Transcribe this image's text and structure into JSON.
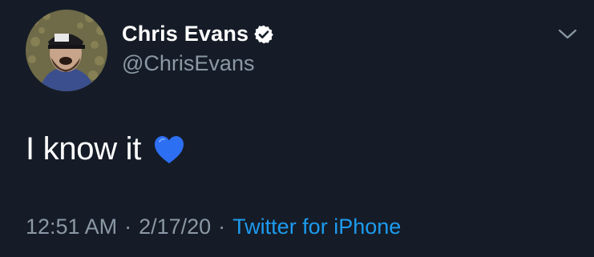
{
  "user": {
    "display_name": "Chris Evans",
    "handle": "@ChrisEvans",
    "verified_icon": "verified-badge-icon",
    "avatar_icon": "profile-photo"
  },
  "tweet": {
    "text": "I know it",
    "emoji_icon": "blue-heart-icon",
    "emoji_color": "#2d6ff3"
  },
  "meta": {
    "time": "12:51 AM",
    "separator": "·",
    "date": "2/17/20",
    "source": "Twitter for iPhone"
  },
  "menu": {
    "icon": "chevron-down-icon"
  },
  "colors": {
    "background": "#151c27",
    "primary_text": "#ffffff",
    "secondary_text": "#8b98a5",
    "link": "#1d9bf0"
  }
}
